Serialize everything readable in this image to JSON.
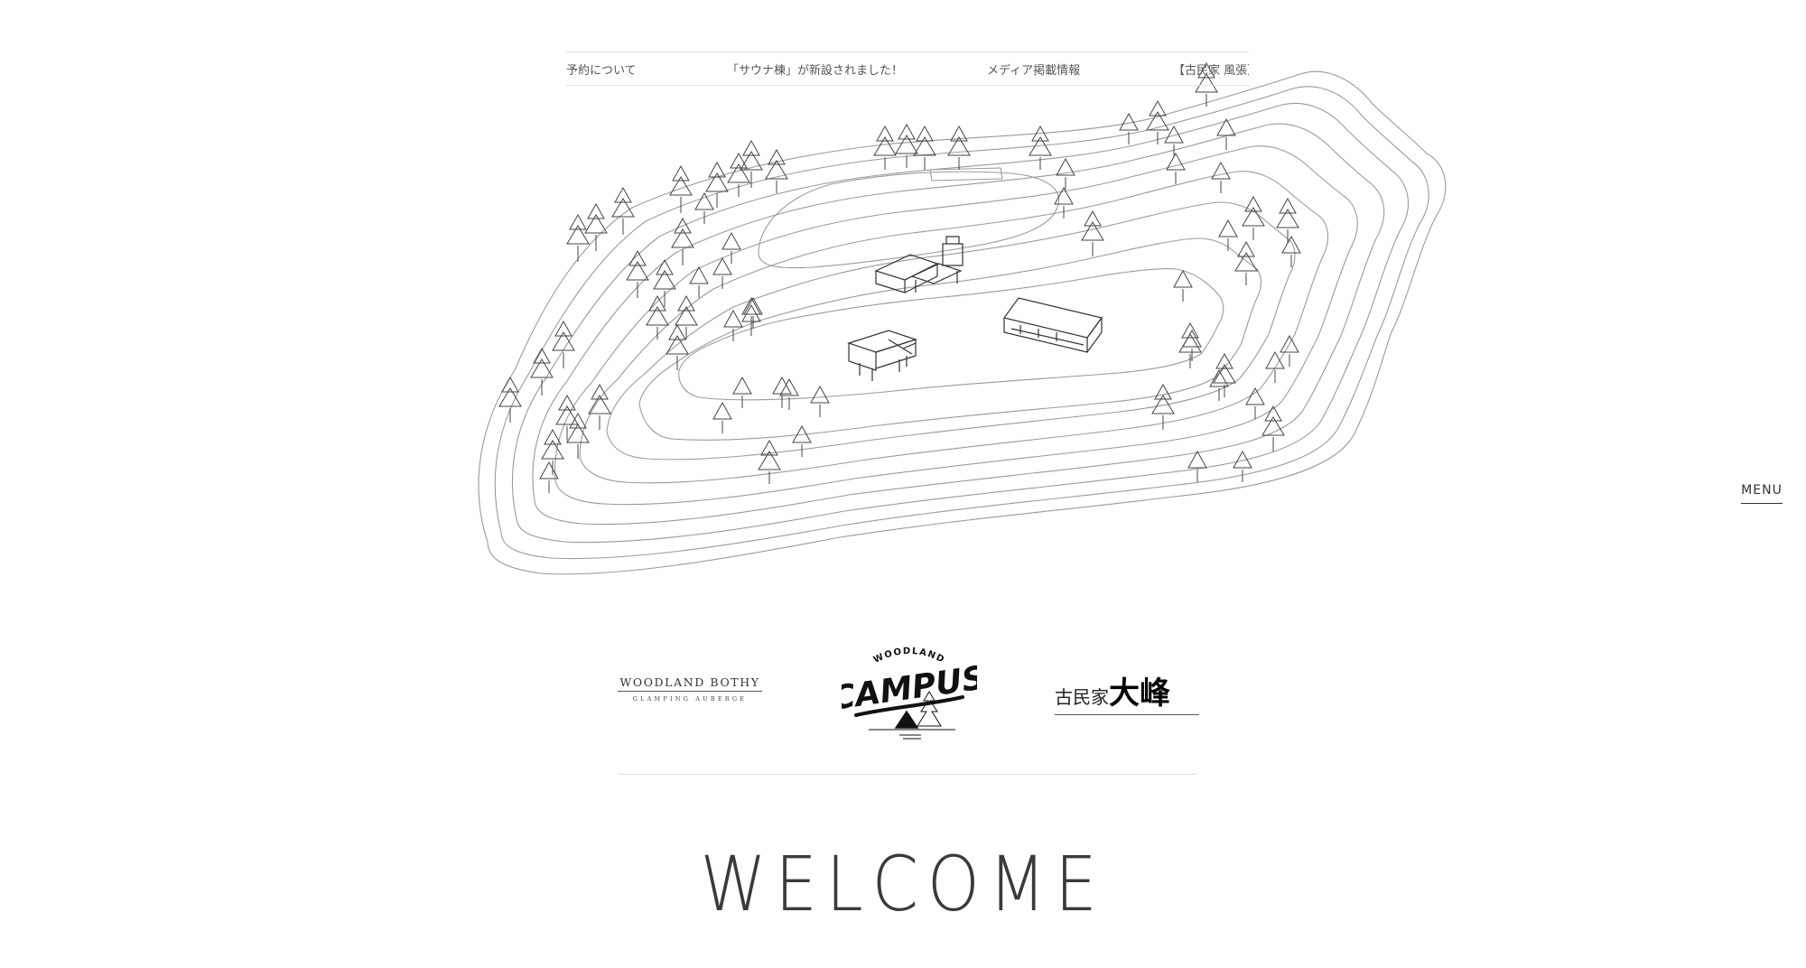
{
  "news_ticker": {
    "items": [
      {
        "label": "予約について"
      },
      {
        "label": "「サウナ棟」が新設されました！"
      },
      {
        "label": "メディア掲載情報"
      },
      {
        "label": "【古民家 風張】"
      }
    ]
  },
  "menu": {
    "label": "MENU"
  },
  "logos": {
    "bothy": {
      "title": "WOODLAND BOTHY",
      "subtitle": "GLAMPING AUBERGE"
    },
    "campus": {
      "top": "WOODLAND",
      "main": "CAMPUS"
    },
    "taiho": {
      "small": "古民家",
      "big": "大峰"
    }
  },
  "hero": {
    "welcome": "WELCOME"
  },
  "colors": {
    "line": "#8c8c8c",
    "text": "#333333",
    "divider": "#dedede"
  }
}
